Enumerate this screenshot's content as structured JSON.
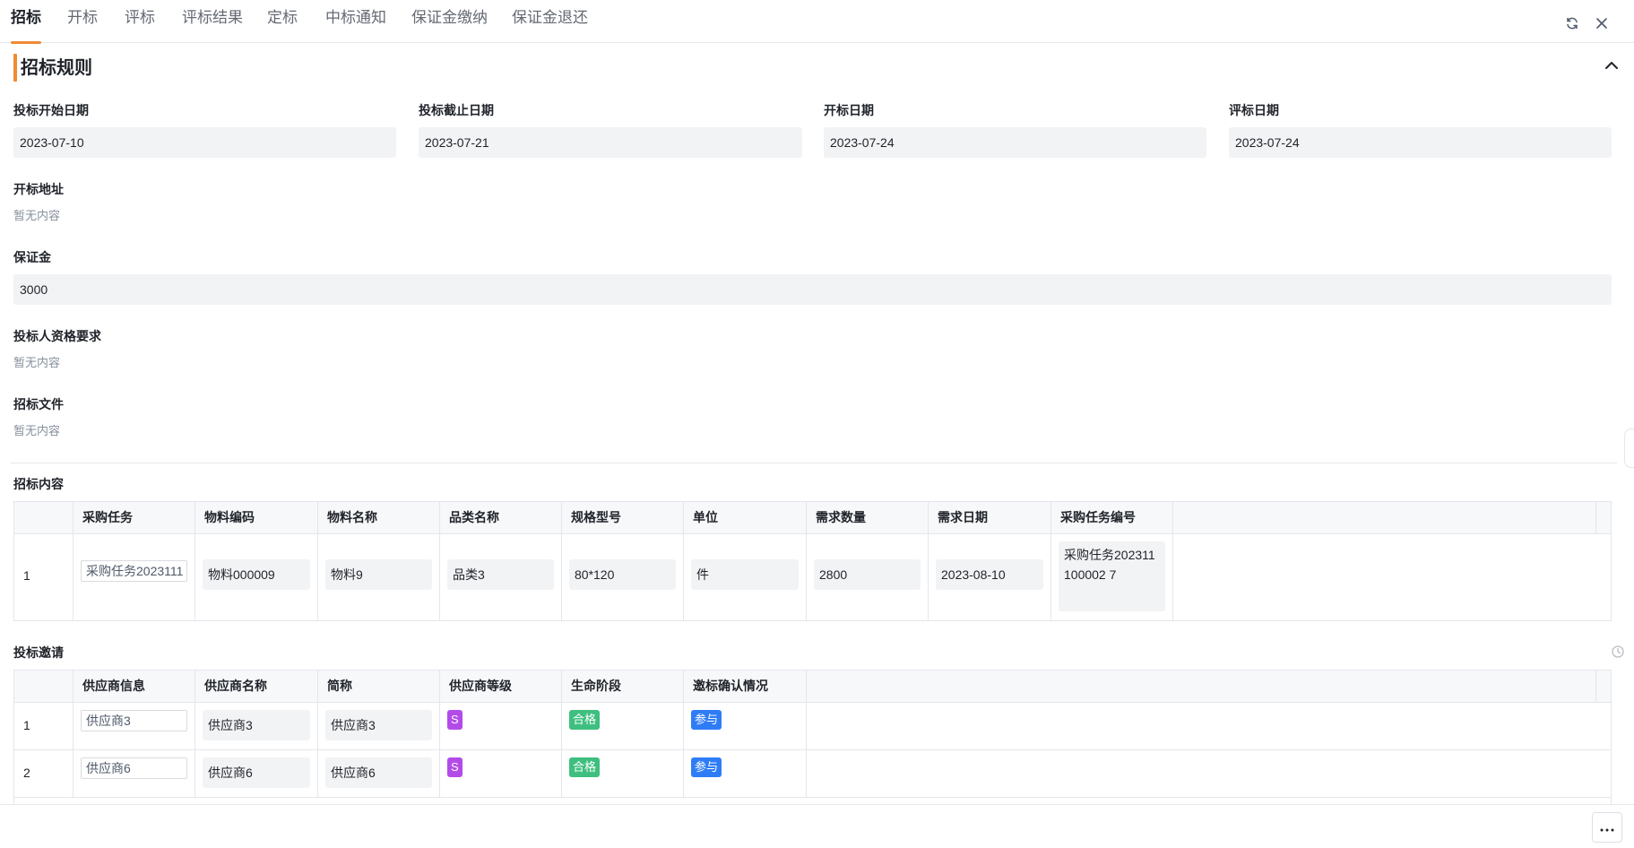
{
  "tabs": [
    {
      "label": "招标",
      "active": true
    },
    {
      "label": "开标"
    },
    {
      "label": "评标"
    },
    {
      "label": "评标结果"
    },
    {
      "label": "定标"
    },
    {
      "label": "中标通知"
    },
    {
      "label": "保证金缴纳"
    },
    {
      "label": "保证金退还"
    }
  ],
  "section_title": "招标规则",
  "fields": {
    "bid_start": {
      "label": "投标开始日期",
      "value": "2023-07-10"
    },
    "bid_end": {
      "label": "投标截止日期",
      "value": "2023-07-21"
    },
    "open_date": {
      "label": "开标日期",
      "value": "2023-07-24"
    },
    "eval_date": {
      "label": "评标日期",
      "value": "2023-07-24"
    },
    "open_address": {
      "label": "开标地址",
      "value": "暂无内容"
    },
    "deposit": {
      "label": "保证金",
      "value": "3000"
    },
    "qualification": {
      "label": "投标人资格要求",
      "value": "暂无内容"
    },
    "tender_docs": {
      "label": "招标文件",
      "value": "暂无内容"
    }
  },
  "content_table": {
    "title": "招标内容",
    "columns": [
      "采购任务",
      "物料编码",
      "物料名称",
      "品类名称",
      "规格型号",
      "单位",
      "需求数量",
      "需求日期",
      "采购任务编号"
    ],
    "rows": [
      {
        "index": "1",
        "task": "采购任务2023111",
        "material_code": "物料000009",
        "material_name": "物料9",
        "category": "品类3",
        "spec": "80*120",
        "unit": "件",
        "quantity": "2800",
        "date": "2023-08-10",
        "task_no": "采购任务202311100002 7"
      }
    ]
  },
  "invite_table": {
    "title": "投标邀请",
    "columns": [
      "供应商信息",
      "供应商名称",
      "简称",
      "供应商等级",
      "生命阶段",
      "邀标确认情况"
    ],
    "rows": [
      {
        "index": "1",
        "info": "供应商3",
        "name": "供应商3",
        "short": "供应商3",
        "level": "S",
        "stage": "合格",
        "confirm": "参与"
      },
      {
        "index": "2",
        "info": "供应商6",
        "name": "供应商6",
        "short": "供应商6",
        "level": "S",
        "stage": "合格",
        "confirm": "参与"
      }
    ]
  },
  "colors": {
    "accent": "#f08a34",
    "level_tag": "#b34be9",
    "stage_tag": "#3fbf7f",
    "confirm_tag": "#2f7df6"
  }
}
